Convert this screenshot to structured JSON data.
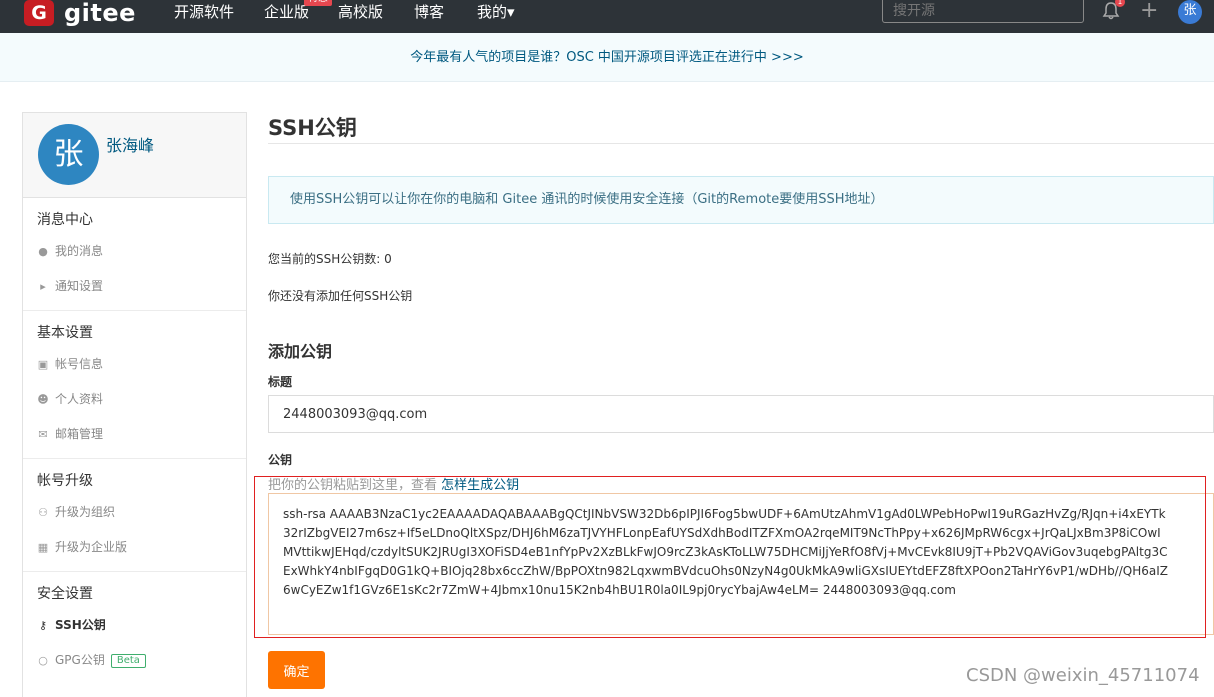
{
  "nav": {
    "logo_letter": "G",
    "logo_text": "gitee",
    "items": [
      "开源软件",
      "企业版",
      "高校版",
      "博客",
      "我的▾"
    ],
    "hot_badge": "特惠",
    "search_placeholder": "搜开源",
    "notification_count": "1",
    "avatar_letter": "张"
  },
  "banner": {
    "text": "今年最有人气的项目是谁？OSC 中国开源项目评选正在进行中 >>>"
  },
  "sidebar": {
    "avatar_letter": "张",
    "username": "张海峰",
    "sections": [
      {
        "title": "消息中心",
        "items": [
          {
            "label": "我的消息",
            "icon": "bell-icon"
          },
          {
            "label": "通知设置",
            "icon": "speaker-icon"
          }
        ]
      },
      {
        "title": "基本设置",
        "items": [
          {
            "label": "帐号信息",
            "icon": "id-card-icon"
          },
          {
            "label": "个人资料",
            "icon": "user-icon"
          },
          {
            "label": "邮箱管理",
            "icon": "mail-icon"
          }
        ]
      },
      {
        "title": "帐号升级",
        "items": [
          {
            "label": "升级为组织",
            "icon": "group-icon"
          },
          {
            "label": "升级为企业版",
            "icon": "building-icon"
          }
        ]
      },
      {
        "title": "安全设置",
        "items": [
          {
            "label": "SSH公钥",
            "icon": "key-icon"
          },
          {
            "label": "GPG公钥",
            "icon": "lock-icon"
          }
        ]
      }
    ],
    "beta_label": "Beta"
  },
  "main": {
    "title": "SSH公钥",
    "info": "使用SSH公钥可以让你在你的电脑和 Gitee 通讯的时候使用安全连接（Git的Remote要使用SSH地址）",
    "count_text": "您当前的SSH公钥数: 0",
    "none_text": "你还没有添加任何SSH公钥",
    "add_heading": "添加公钥",
    "title_label": "标题",
    "title_value": "2448003093@qq.com",
    "key_label": "公钥",
    "key_hint": "把你的公钥粘贴到这里，查看",
    "key_hint_link": "怎样生成公钥",
    "key_value": "ssh-rsa AAAAB3NzaC1yc2EAAAADAQABAAABgQCtJINbVSW32Db6pIPJI6Fog5bwUDF+6AmUtzAhmV1gAd0LWPebHoPwI19uRGazHvZg/RJqn+i4xEYTk\n32rIZbgVEI27m6sz+If5eLDnoQltXSpz/DHJ6hM6zaTJVYHFLonpEafUYSdXdhBodITZFXmOA2rqeMIT9NcThPpy+x626JMpRW6cgx+JrQaLJxBm3P8iCOwI\nMVttikwJEHqd/czdyltSUK2JRUgI3XOFiSD4eB1nfYpPv2XzBLkFwJO9rcZ3kAsKToLLW75DHCMiJjYeRfO8fVj+MvCEvk8IU9jT+Pb2VQAViGov3uqebgPAltg3C\nExWhkY4nbIFgqD0G1kQ+BIOjq28bx6ccZhW/BpPOXtn982LqxwmBVdcuOhs0NzyN4g0UkMkA9wliGXsIUEYtdEFZ8ftXPOon2TaHrY6vP1/wDHb//QH6aIZ\n6wCyEZw1f1GVz6E1sKc2r7ZmW+4Jbmx10nu15K2nb4hBU1R0la0IL9pj0rycYbajAw4eLM= 2448003093@qq.com",
    "confirm_label": "确定"
  },
  "watermark": "CSDN @weixin_45711074",
  "colors": {
    "nav_bg": "#2d3338",
    "brand_red": "#c71d23",
    "confirm_orange": "#fe7300",
    "link_blue": "#005980"
  }
}
